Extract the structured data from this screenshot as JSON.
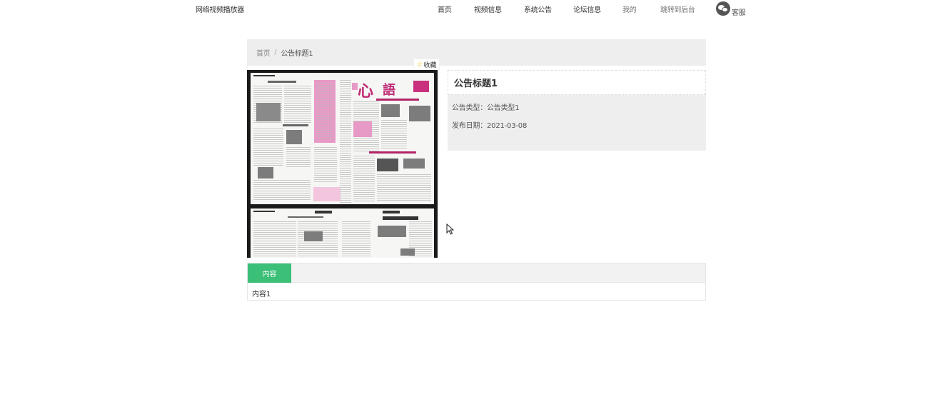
{
  "header": {
    "brand": "网络视频播放器",
    "nav": [
      {
        "label": "首页"
      },
      {
        "label": "视频信息"
      },
      {
        "label": "系统公告"
      },
      {
        "label": "论坛信息"
      },
      {
        "label": "我的"
      },
      {
        "label": "跳转到后台"
      }
    ],
    "service_label": "客服",
    "service_icon": "wechat-icon"
  },
  "breadcrumb": {
    "home": "首页",
    "separator": "/",
    "current": "公告标题1"
  },
  "collect": {
    "icon": "star-icon",
    "label": "收藏"
  },
  "detail": {
    "title": "公告标题1",
    "type_label": "公告类型：",
    "type_value": "公告类型1",
    "date_label": "发布日期：",
    "date_value": "2021-03-08"
  },
  "tabs": {
    "items": [
      {
        "label": "内容"
      }
    ],
    "content": "内容1"
  },
  "colors": {
    "accent_green": "#3cbf77",
    "panel_gray": "#eeeeef"
  }
}
